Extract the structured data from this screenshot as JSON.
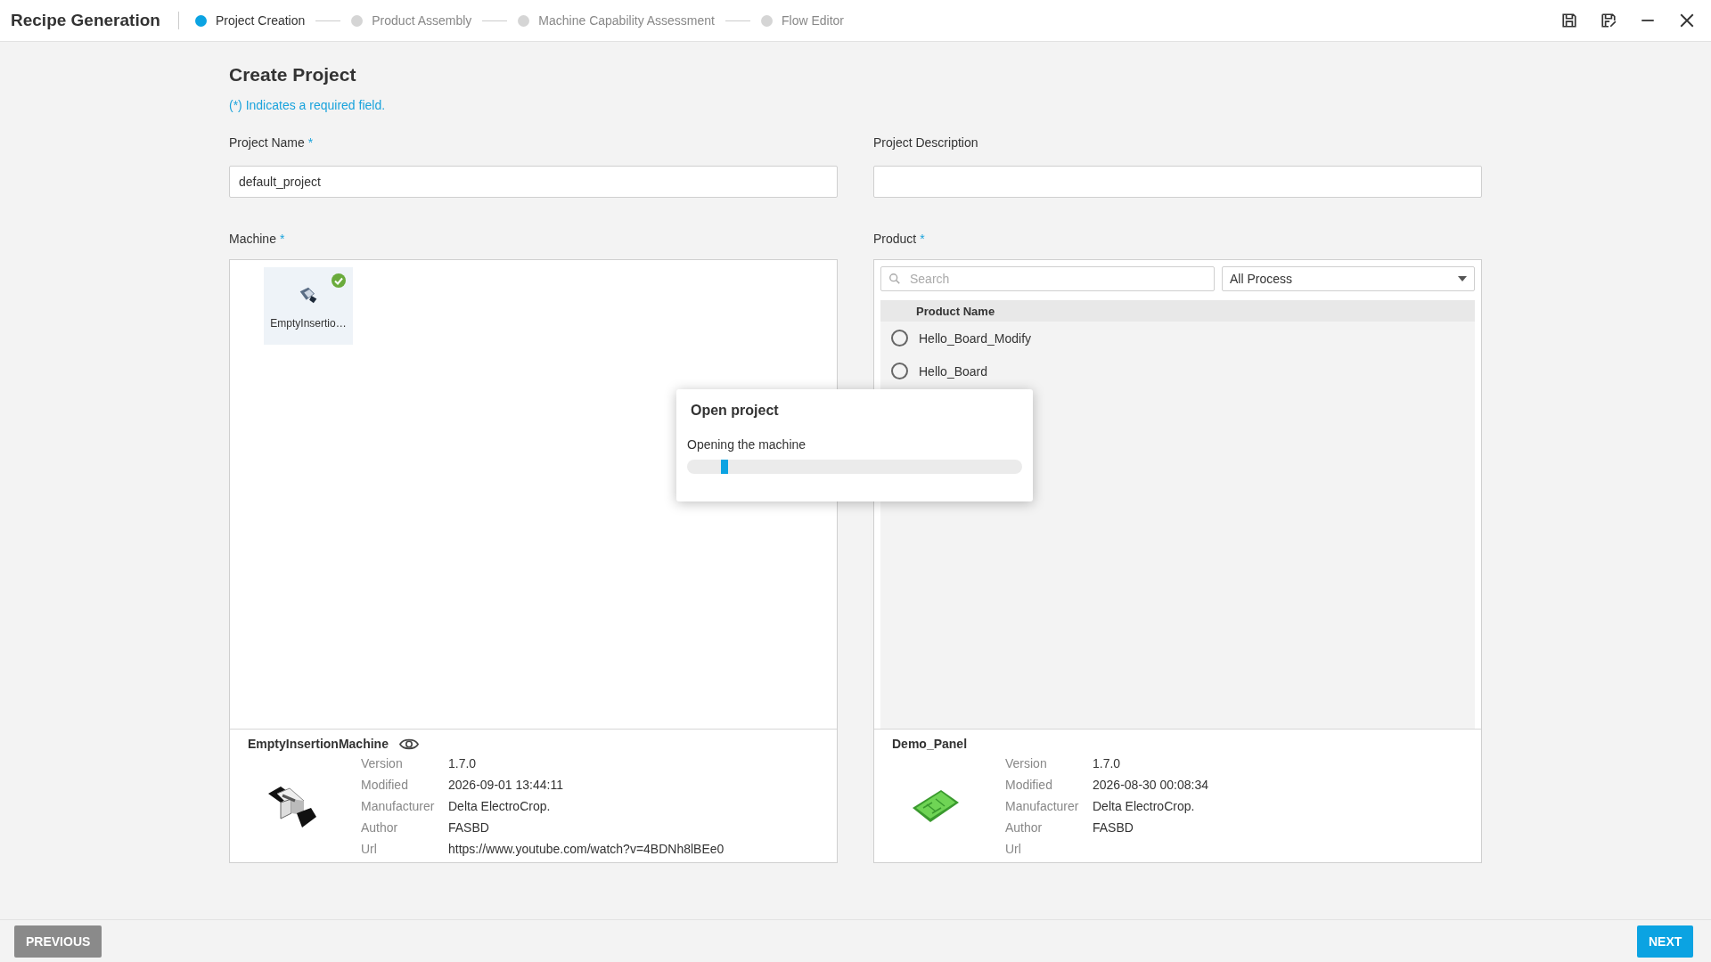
{
  "app": {
    "title": "Recipe Generation"
  },
  "steps": [
    {
      "label": "Project Creation",
      "selected": true
    },
    {
      "label": "Product Assembly",
      "selected": false
    },
    {
      "label": "Machine Capability Assessment",
      "selected": false
    },
    {
      "label": "Flow Editor",
      "selected": false
    }
  ],
  "page": {
    "title": "Create Project",
    "required_note": "(*) Indicates a required field."
  },
  "fields": [
    {
      "label": "Project Name",
      "required_mark": "*",
      "value": "default_project"
    },
    {
      "label": "Project Description"
    }
  ],
  "machine": {
    "label": "Machine",
    "required_mark": "*",
    "tiles": [
      {
        "name": "EmptyInsertio…",
        "checked": true
      }
    ],
    "details": {
      "name": "EmptyInsertionMachine",
      "rows": [
        {
          "label": "Version",
          "value": "1.7.0"
        },
        {
          "label": "Modified",
          "value": "2026-09-01 13:44:11"
        },
        {
          "label": "Manufacturer",
          "value": "Delta ElectroCrop."
        },
        {
          "label": "Author",
          "value": "FASBD"
        },
        {
          "label": "Url",
          "value": "https://www.youtube.com/watch?v=4BDNh8lBEe0"
        }
      ]
    }
  },
  "product": {
    "label": "Product",
    "required_mark": "*",
    "search": {
      "placeholder": "Search"
    },
    "filter": {
      "value": "All Process"
    },
    "column": "Product Name",
    "items": [
      {
        "name": "Hello_Board_Modify",
        "selected": false
      },
      {
        "name": "Hello_Board",
        "selected": false
      }
    ],
    "details": {
      "name": "Demo_Panel",
      "rows": [
        {
          "label": "Version",
          "value": "1.7.0"
        },
        {
          "label": "Modified",
          "value": "2026-08-30 00:08:34"
        },
        {
          "label": "Manufacturer",
          "value": "Delta ElectroCrop."
        },
        {
          "label": "Author",
          "value": "FASBD"
        },
        {
          "label": "Url"
        }
      ]
    }
  },
  "dialog": {
    "title": "Open project",
    "message": "Opening the machine",
    "level": 0.1
  },
  "footer": {
    "previous": "PREVIOUS",
    "next": "NEXT"
  }
}
